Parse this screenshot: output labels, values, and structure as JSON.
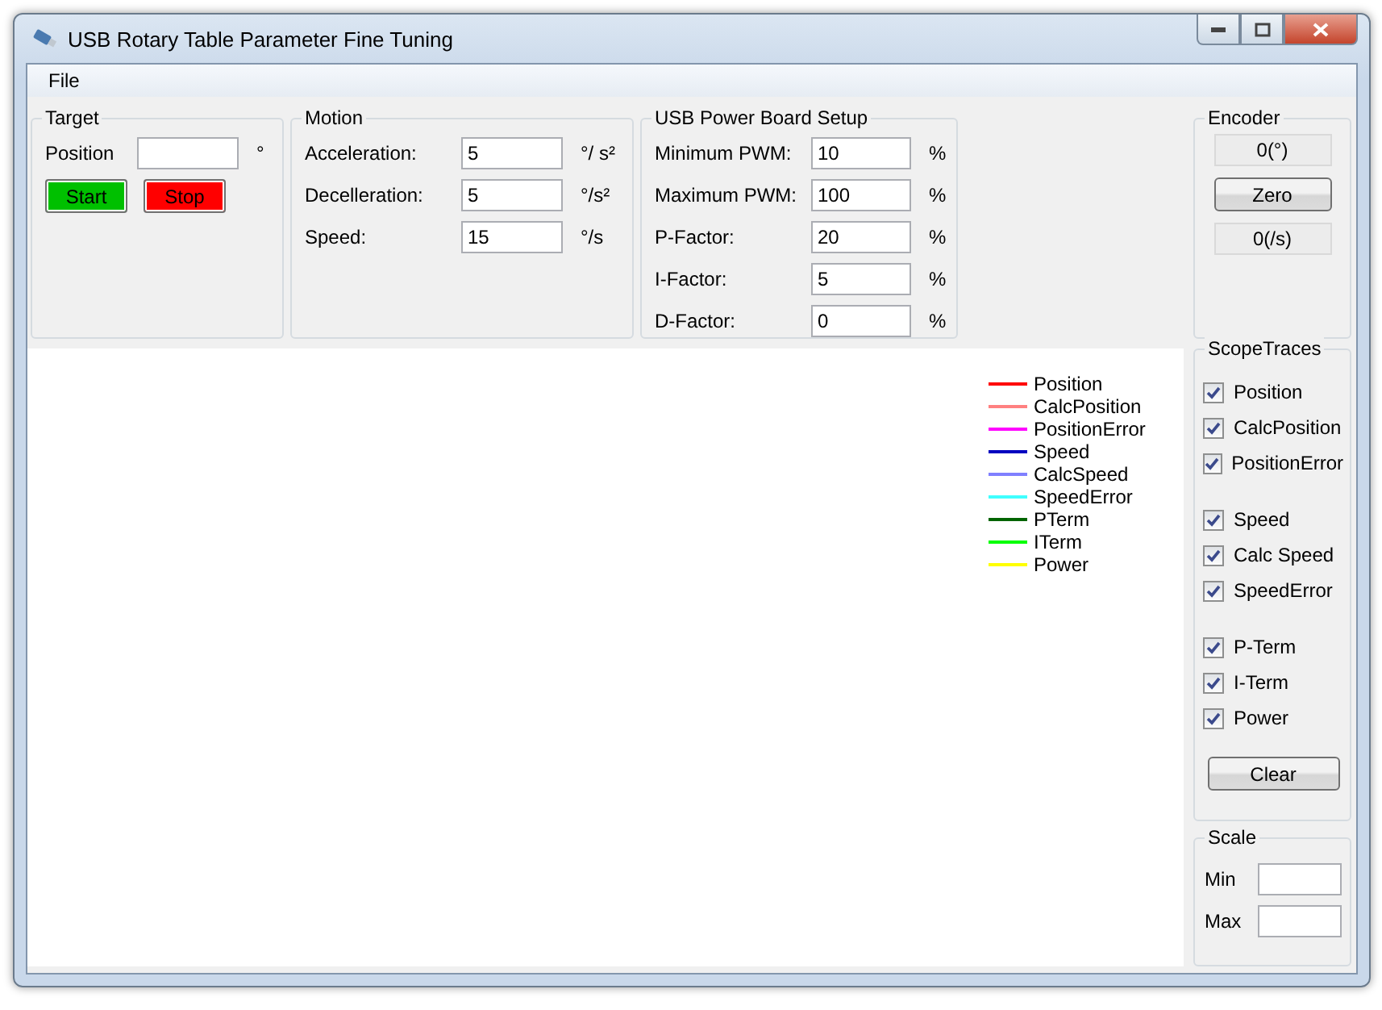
{
  "window": {
    "title": "USB Rotary Table Parameter Fine Tuning"
  },
  "menu": [
    "File"
  ],
  "target": {
    "title": "Target",
    "fields": [
      {
        "label": "Position",
        "unit": "°"
      }
    ],
    "buttons": [
      {
        "label": "Start",
        "color": "#00c000"
      },
      {
        "label": "Stop",
        "color": "#ff0000"
      }
    ]
  },
  "motion": {
    "title": "Motion",
    "fields": [
      {
        "label": "Acceleration:",
        "value": "5",
        "unit": "°/ s²"
      },
      {
        "label": "Decelleration:",
        "value": "5",
        "unit": "°/s²"
      },
      {
        "label": "Speed:",
        "value": "15",
        "unit": "°/s"
      }
    ]
  },
  "power_board": {
    "title": "USB Power Board Setup",
    "fields": [
      {
        "label": "Minimum PWM:",
        "value": "10",
        "unit": "%"
      },
      {
        "label": "Maximum PWM:",
        "value": "100",
        "unit": "%"
      },
      {
        "label": "P-Factor:",
        "value": "20",
        "unit": "%"
      },
      {
        "label": "I-Factor:",
        "value": "5",
        "unit": "%"
      },
      {
        "label": "D-Factor:",
        "value": "0",
        "unit": "%"
      }
    ]
  },
  "encoder": {
    "title": "Encoder",
    "items": [
      {
        "kind": "readout",
        "text": "0(°)"
      },
      {
        "kind": "button",
        "text": "Zero"
      },
      {
        "kind": "readout",
        "text": "0(/s)"
      }
    ]
  },
  "plot": {
    "legend": [
      {
        "label": "Position",
        "color": "#ff0000"
      },
      {
        "label": "CalcPosition",
        "color": "#ff8080"
      },
      {
        "label": "PositionError",
        "color": "#ff00ff"
      },
      {
        "label": "Speed",
        "color": "#0000c0"
      },
      {
        "label": "CalcSpeed",
        "color": "#8080ff"
      },
      {
        "label": "SpeedError",
        "color": "#40ffff"
      },
      {
        "label": "PTerm",
        "color": "#006400"
      },
      {
        "label": "ITerm",
        "color": "#00ff00"
      },
      {
        "label": "Power",
        "color": "#ffff00"
      }
    ]
  },
  "scope_traces": {
    "title": "ScopeTraces",
    "groups": [
      [
        {
          "label": "Position",
          "checked": true
        },
        {
          "label": "CalcPosition",
          "checked": true
        },
        {
          "label": "PositionError",
          "checked": true
        }
      ],
      [
        {
          "label": "Speed",
          "checked": true
        },
        {
          "label": "Calc Speed",
          "checked": true
        },
        {
          "label": "SpeedError",
          "checked": true
        }
      ],
      [
        {
          "label": "P-Term",
          "checked": true
        },
        {
          "label": "I-Term",
          "checked": true
        },
        {
          "label": "Power",
          "checked": true
        }
      ]
    ],
    "button": "Clear"
  },
  "scale": {
    "title": "Scale",
    "fields": [
      {
        "label": "Min"
      },
      {
        "label": "Max"
      }
    ]
  }
}
